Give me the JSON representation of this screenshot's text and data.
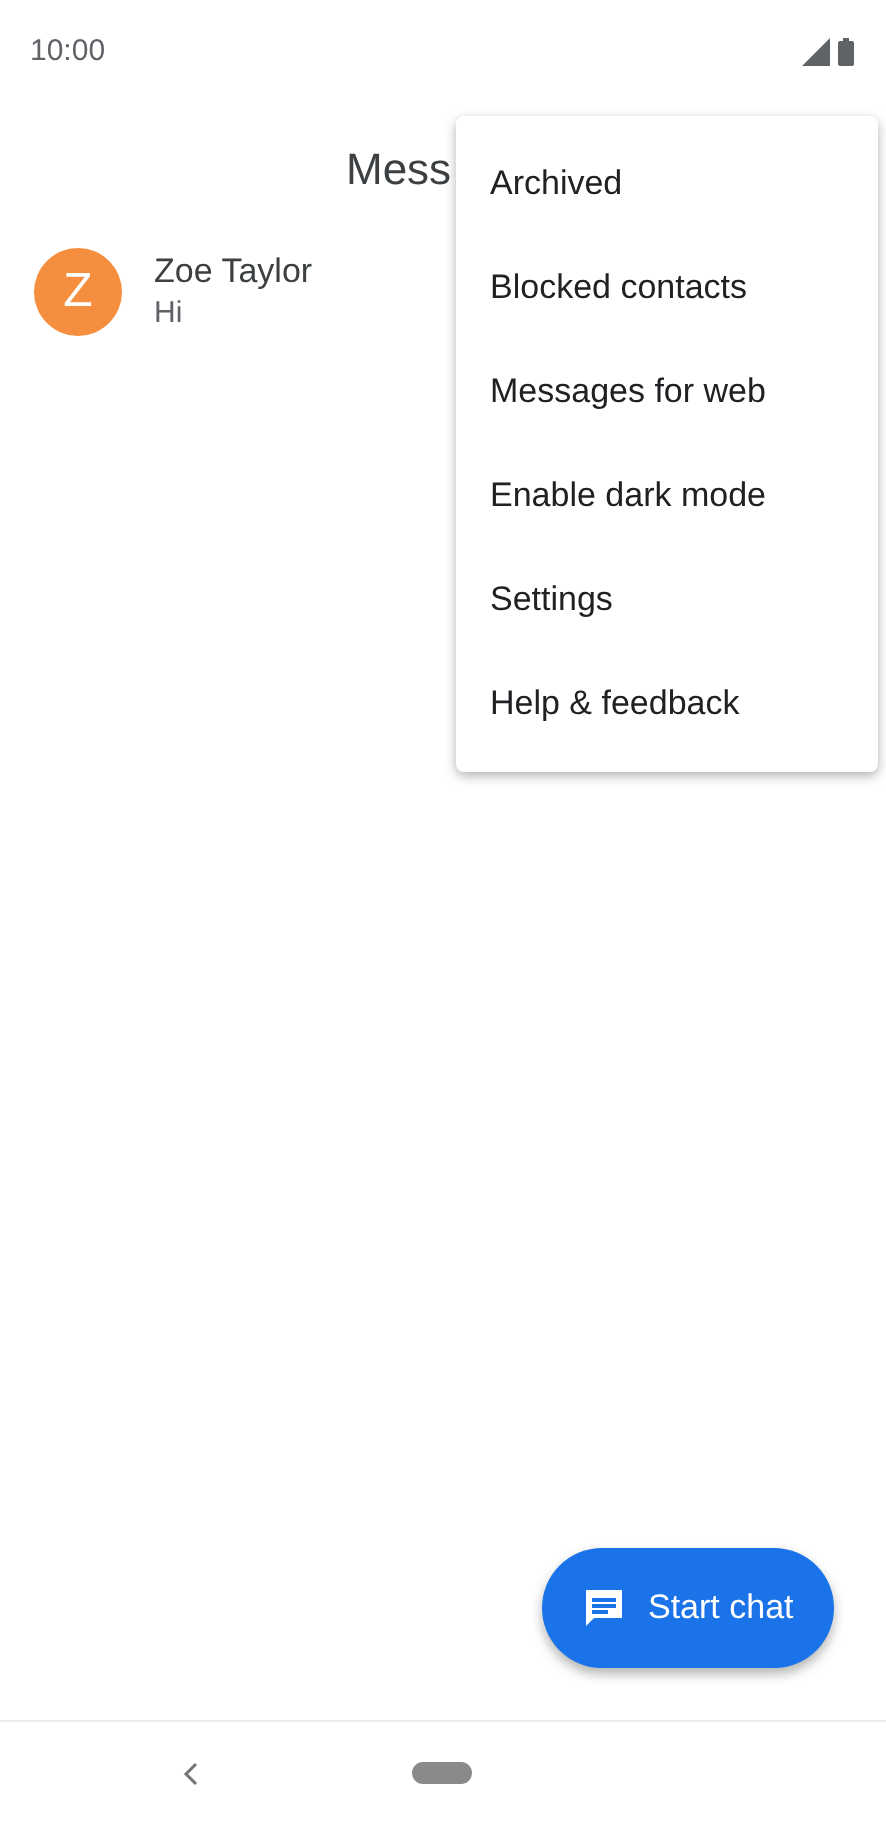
{
  "status_bar": {
    "time": "10:00"
  },
  "app_bar": {
    "title": "Mess"
  },
  "conversations": [
    {
      "avatar_letter": "Z",
      "color": "#f58f3f",
      "name": "Zoe Taylor",
      "snippet": "Hi"
    }
  ],
  "menu": {
    "items": [
      "Archived",
      "Blocked contacts",
      "Messages for web",
      "Enable dark mode",
      "Settings",
      "Help & feedback"
    ]
  },
  "fab": {
    "label": "Start chat"
  }
}
